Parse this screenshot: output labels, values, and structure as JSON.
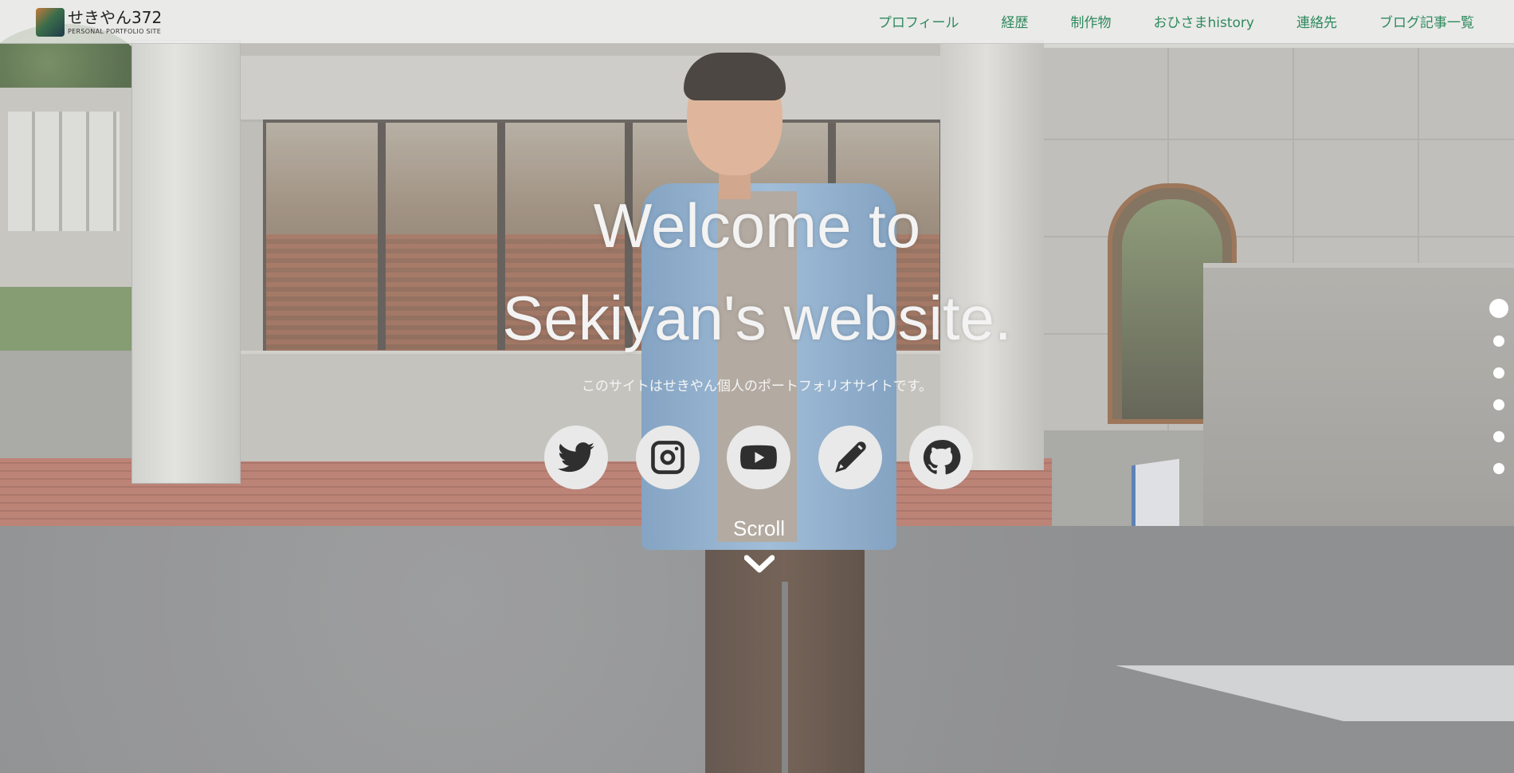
{
  "header": {
    "logo_title": "せきやん372",
    "logo_subtitle": "PERSONAL PORTFOLIO SITE",
    "nav": [
      {
        "label": "プロフィール"
      },
      {
        "label": "経歴"
      },
      {
        "label": "制作物"
      },
      {
        "label": "おひさまhistory"
      },
      {
        "label": "連絡先"
      },
      {
        "label": "ブログ記事一覧"
      }
    ]
  },
  "hero": {
    "title_line1": "Welcome to",
    "title_line2": "Sekiyan's website.",
    "subtitle": "このサイトはせきやん個人のポートフォリオサイトです。",
    "scroll_label": "Scroll"
  },
  "socials": [
    {
      "icon": "twitter-icon"
    },
    {
      "icon": "instagram-icon"
    },
    {
      "icon": "youtube-icon"
    },
    {
      "icon": "pen-icon"
    },
    {
      "icon": "github-icon"
    }
  ],
  "page_dots": {
    "count": 6,
    "active_index": 0
  },
  "colors": {
    "nav_text": "#2e8a5e",
    "header_bg": "#f0f0ee",
    "social_bg": "#e9e9e9",
    "icon": "#2f2f2f"
  }
}
